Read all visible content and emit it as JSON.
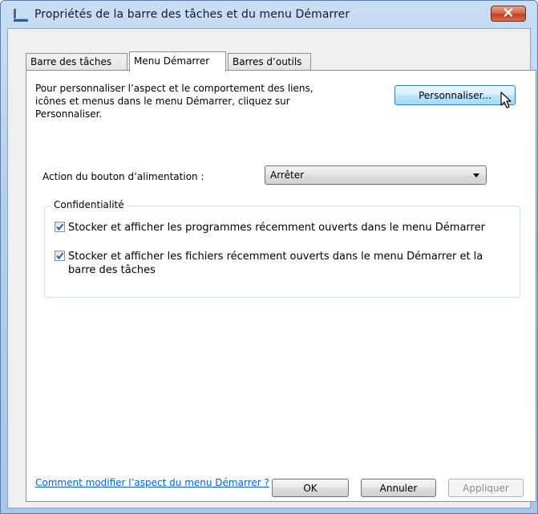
{
  "window": {
    "title": "Propriétés de la barre des tâches et du menu Démarrer"
  },
  "tabs": [
    {
      "label": "Barre des tâches",
      "active": false
    },
    {
      "label": "Menu Démarrer",
      "active": true
    },
    {
      "label": "Barres d’outils",
      "active": false
    }
  ],
  "content": {
    "intro_text": "Pour personnaliser l’aspect et le comportement des liens, icônes et menus dans le menu Démarrer, cliquez sur Personnaliser.",
    "customize_button": "Personnaliser...",
    "power_label": "Action du bouton d’alimentation :",
    "power_value": "Arrêter",
    "privacy": {
      "legend": "Confidentialité",
      "options": [
        {
          "label": "Stocker et afficher les programmes récemment ouverts dans le menu Démarrer",
          "checked": true
        },
        {
          "label": "Stocker et afficher les fichiers récemment ouverts dans le menu Démarrer et la barre des tâches",
          "checked": true
        }
      ]
    },
    "help_link": "Comment modifier l’aspect du menu Démarrer ?"
  },
  "footer": {
    "ok": "OK",
    "cancel": "Annuler",
    "apply": "Appliquer"
  },
  "colors": {
    "link": "#0066cc",
    "close_button": "#c0401f",
    "checkmark": "#2a5fa8"
  }
}
